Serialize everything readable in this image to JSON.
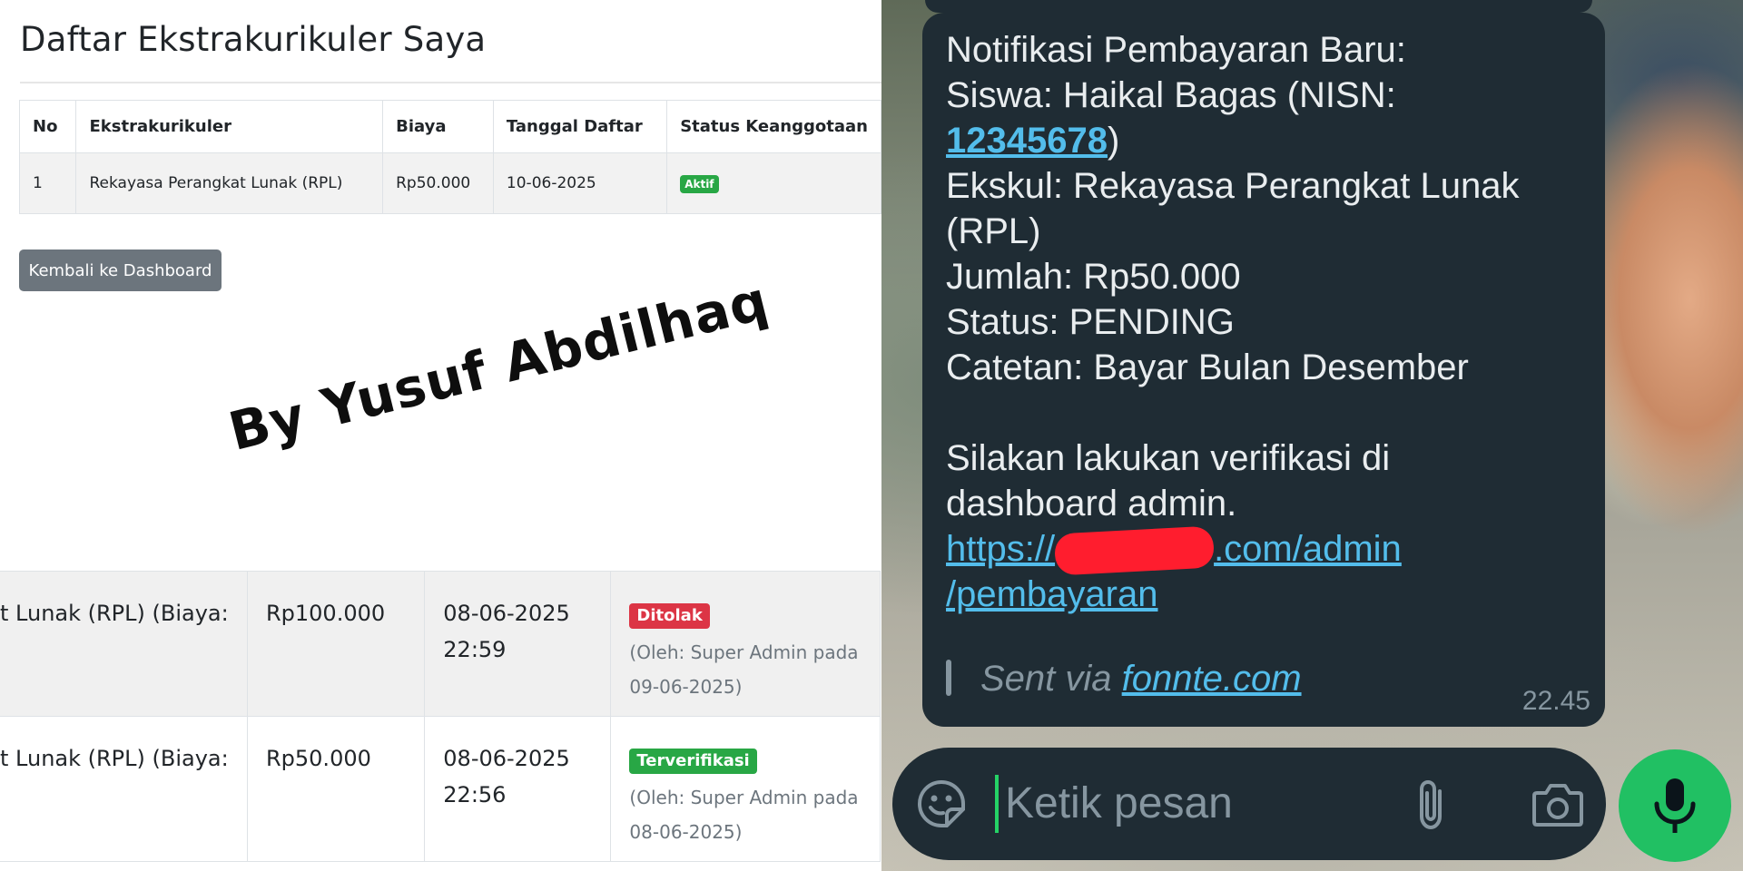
{
  "left": {
    "page_title": "Daftar Ekstrakurikuler Saya",
    "table": {
      "headers": [
        "No",
        "Ekstrakurikuler",
        "Biaya",
        "Tanggal Daftar",
        "Status Keanggotaan"
      ],
      "rows": [
        {
          "no": "1",
          "ekskul": "Rekayasa Perangkat Lunak (RPL)",
          "biaya": "Rp50.000",
          "tanggal": "10-06-2025",
          "status": "Aktif"
        }
      ]
    },
    "back_button": "Kembali ke Dashboard",
    "watermark": "By Yusuf Abdilhaq",
    "payments": [
      {
        "desc": "t Lunak (RPL) (Biaya:",
        "amount": "Rp100.000",
        "date": "08-06-2025",
        "time": "22:59",
        "status": "Ditolak",
        "status_color": "#dc3545",
        "note": "(Oleh: Super Admin pada 09-06-2025)"
      },
      {
        "desc": "t Lunak (RPL) (Biaya:",
        "amount": "Rp50.000",
        "date": "08-06-2025",
        "time": "22:56",
        "status": "Terverifikasi",
        "status_color": "#28a745",
        "note": "(Oleh: Super Admin pada 08-06-2025)"
      }
    ]
  },
  "chat": {
    "message": {
      "line1": "Notifikasi Pembayaran Baru:",
      "line2": "Siswa: Haikal Bagas (NISN:",
      "nisn": "12345678",
      "nisn_close": ")",
      "line4": "Ekskul: Rekayasa Perangkat Lunak",
      "line5": "(RPL)",
      "line6": "Jumlah: Rp50.000",
      "line7": "Status: PENDING",
      "line8": "Catetan: Bayar Bulan Desember",
      "line10": "Silakan lakukan verifikasi di",
      "line11": "dashboard admin.",
      "link_prefix": "https://",
      "link_suffix": ".com/admin",
      "link_line2": "/pembayaran",
      "sent_via_prefix": "Sent via ",
      "sent_via_link": "fonnte.com",
      "time": "22.45"
    },
    "composer": {
      "placeholder": "Ketik pesan",
      "icons": [
        "sticker-icon",
        "paperclip-icon",
        "camera-icon",
        "microphone-icon"
      ]
    },
    "colors": {
      "bubble": "#1f2c34",
      "link": "#53bdeb",
      "mic_button": "#21c063",
      "redaction": "#ff1d2e"
    }
  }
}
